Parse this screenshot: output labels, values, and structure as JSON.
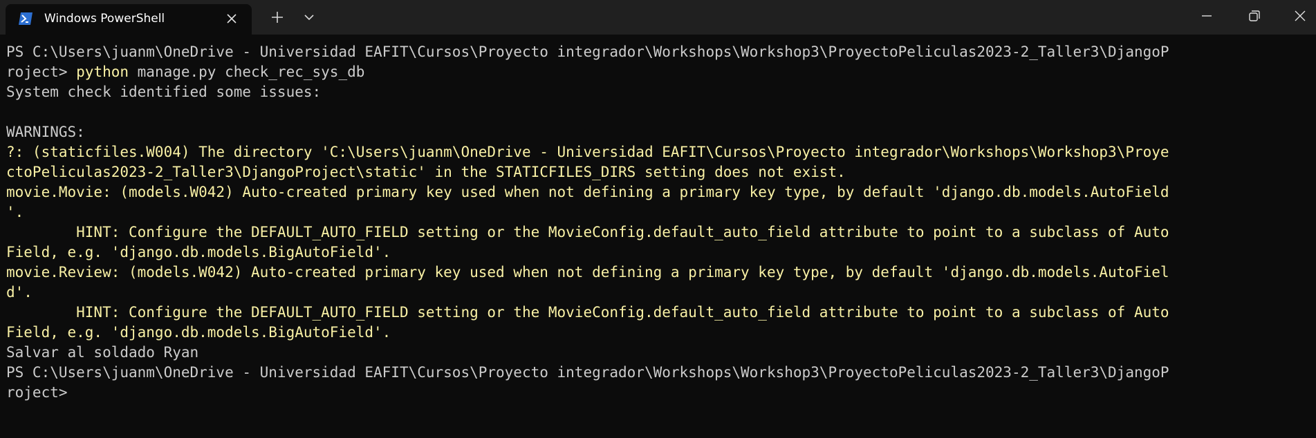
{
  "window": {
    "tab_title": "Windows PowerShell",
    "tab_icon": "powershell-icon",
    "close_tab_icon": "close-icon",
    "new_tab_icon": "plus-icon",
    "dropdown_icon": "chevron-down-icon",
    "minimize_icon": "minimize-icon",
    "maximize_icon": "restore-icon",
    "close_window_icon": "close-icon"
  },
  "colors": {
    "background": "#0c0c0c",
    "titlebar": "#202020",
    "text": "#cccccc",
    "warning_yellow": "#f9f1a5",
    "powershell_blue": "#2c6fd1"
  },
  "console": {
    "lines": [
      {
        "segments": [
          {
            "text": "PS C:\\Users\\juanm\\OneDrive - Universidad EAFIT\\Cursos\\Proyecto integrador\\Workshops\\Workshop3\\ProyectoPeliculas2023-2_Taller3\\DjangoP",
            "color": "gray"
          }
        ]
      },
      {
        "segments": [
          {
            "text": "roject> ",
            "color": "gray"
          },
          {
            "text": "python",
            "color": "yellow"
          },
          {
            "text": " manage.py check_rec_sys_db",
            "color": "gray"
          }
        ]
      },
      {
        "segments": [
          {
            "text": "System check identified some issues:",
            "color": "gray"
          }
        ]
      },
      {
        "segments": [
          {
            "text": "",
            "color": "gray"
          }
        ]
      },
      {
        "segments": [
          {
            "text": "WARNINGS:",
            "color": "gray"
          }
        ]
      },
      {
        "segments": [
          {
            "text": "?: (staticfiles.W004) The directory 'C:\\Users\\juanm\\OneDrive - Universidad EAFIT\\Cursos\\Proyecto integrador\\Workshops\\Workshop3\\Proye",
            "color": "yellow"
          }
        ]
      },
      {
        "segments": [
          {
            "text": "ctoPeliculas2023-2_Taller3\\DjangoProject\\static' in the STATICFILES_DIRS setting does not exist.",
            "color": "yellow"
          }
        ]
      },
      {
        "segments": [
          {
            "text": "movie.Movie: (models.W042) Auto-created primary key used when not defining a primary key type, by default 'django.db.models.AutoField",
            "color": "yellow"
          }
        ]
      },
      {
        "segments": [
          {
            "text": "'.",
            "color": "yellow"
          }
        ]
      },
      {
        "segments": [
          {
            "text": "        HINT: Configure the DEFAULT_AUTO_FIELD setting or the MovieConfig.default_auto_field attribute to point to a subclass of Auto",
            "color": "yellow"
          }
        ]
      },
      {
        "segments": [
          {
            "text": "Field, e.g. 'django.db.models.BigAutoField'.",
            "color": "yellow"
          }
        ]
      },
      {
        "segments": [
          {
            "text": "movie.Review: (models.W042) Auto-created primary key used when not defining a primary key type, by default 'django.db.models.AutoFiel",
            "color": "yellow"
          }
        ]
      },
      {
        "segments": [
          {
            "text": "d'.",
            "color": "yellow"
          }
        ]
      },
      {
        "segments": [
          {
            "text": "        HINT: Configure the DEFAULT_AUTO_FIELD setting or the MovieConfig.default_auto_field attribute to point to a subclass of Auto",
            "color": "yellow"
          }
        ]
      },
      {
        "segments": [
          {
            "text": "Field, e.g. 'django.db.models.BigAutoField'.",
            "color": "yellow"
          }
        ]
      },
      {
        "segments": [
          {
            "text": "Salvar al soldado Ryan",
            "color": "gray"
          }
        ]
      },
      {
        "segments": [
          {
            "text": "PS C:\\Users\\juanm\\OneDrive - Universidad EAFIT\\Cursos\\Proyecto integrador\\Workshops\\Workshop3\\ProyectoPeliculas2023-2_Taller3\\DjangoP",
            "color": "gray"
          }
        ]
      },
      {
        "segments": [
          {
            "text": "roject>",
            "color": "gray"
          }
        ]
      }
    ]
  }
}
